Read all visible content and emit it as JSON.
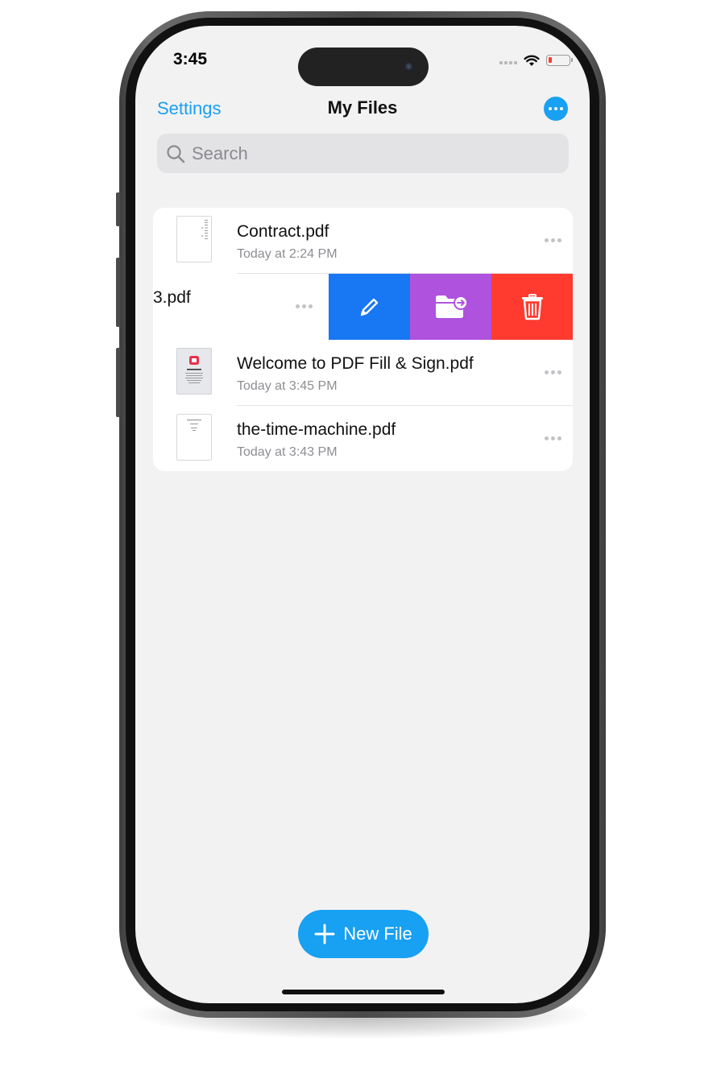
{
  "status_bar": {
    "time": "3:45"
  },
  "nav": {
    "left_label": "Settings",
    "title": "My Files",
    "more_icon": "ellipsis-circle-icon"
  },
  "search": {
    "placeholder": "Search"
  },
  "files": [
    {
      "name": "Contract.pdf",
      "date": "Today at 2:24 PM"
    },
    {
      "name": "3.pdf",
      "swiped": true,
      "actions": [
        "pencil-icon",
        "folder-move-icon",
        "trash-icon"
      ]
    },
    {
      "name": "Welcome to PDF Fill & Sign.pdf",
      "date": "Today at 3:45 PM"
    },
    {
      "name": "the-time-machine.pdf",
      "date": "Today at 3:43 PM"
    }
  ],
  "new_file": {
    "label": "New File"
  },
  "colors": {
    "accent": "#18a0f2",
    "edit_action": "#1877f2",
    "move_action": "#af52de",
    "delete_action": "#ff3b30",
    "background": "#f2f2f3"
  }
}
